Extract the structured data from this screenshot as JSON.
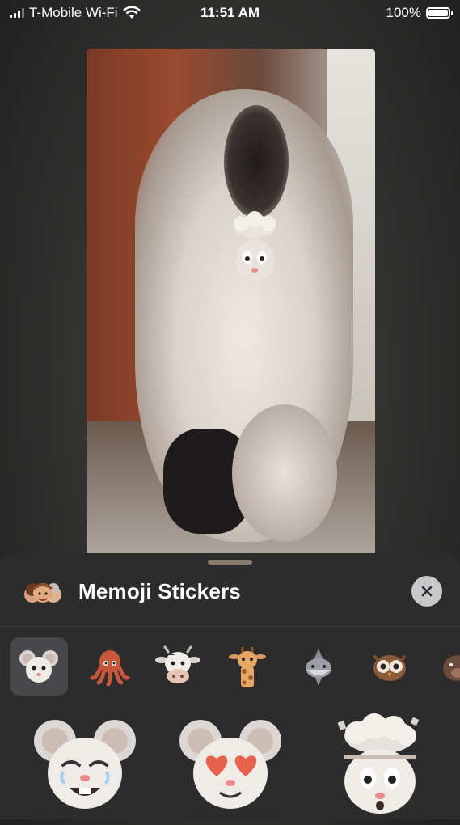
{
  "status_bar": {
    "carrier": "T-Mobile Wi-Fi",
    "time": "11:51 AM",
    "battery": "100%",
    "battery_level": 1.0
  },
  "sheet": {
    "title": "Memoji Stickers",
    "close_icon": "close-icon",
    "characters": [
      {
        "name": "mouse",
        "selected": true
      },
      {
        "name": "octopus",
        "selected": false
      },
      {
        "name": "cow",
        "selected": false
      },
      {
        "name": "giraffe",
        "selected": false
      },
      {
        "name": "shark",
        "selected": false
      },
      {
        "name": "owl",
        "selected": false
      },
      {
        "name": "boar",
        "selected": false
      }
    ],
    "stickers": [
      "mouse-laughing",
      "mouse-heart-eyes",
      "mouse-mind-blown"
    ]
  },
  "colors": {
    "sheet_bg": "#2c2c2d",
    "selected_bg": "#48484a",
    "close_bg": "#c8c7c9"
  }
}
